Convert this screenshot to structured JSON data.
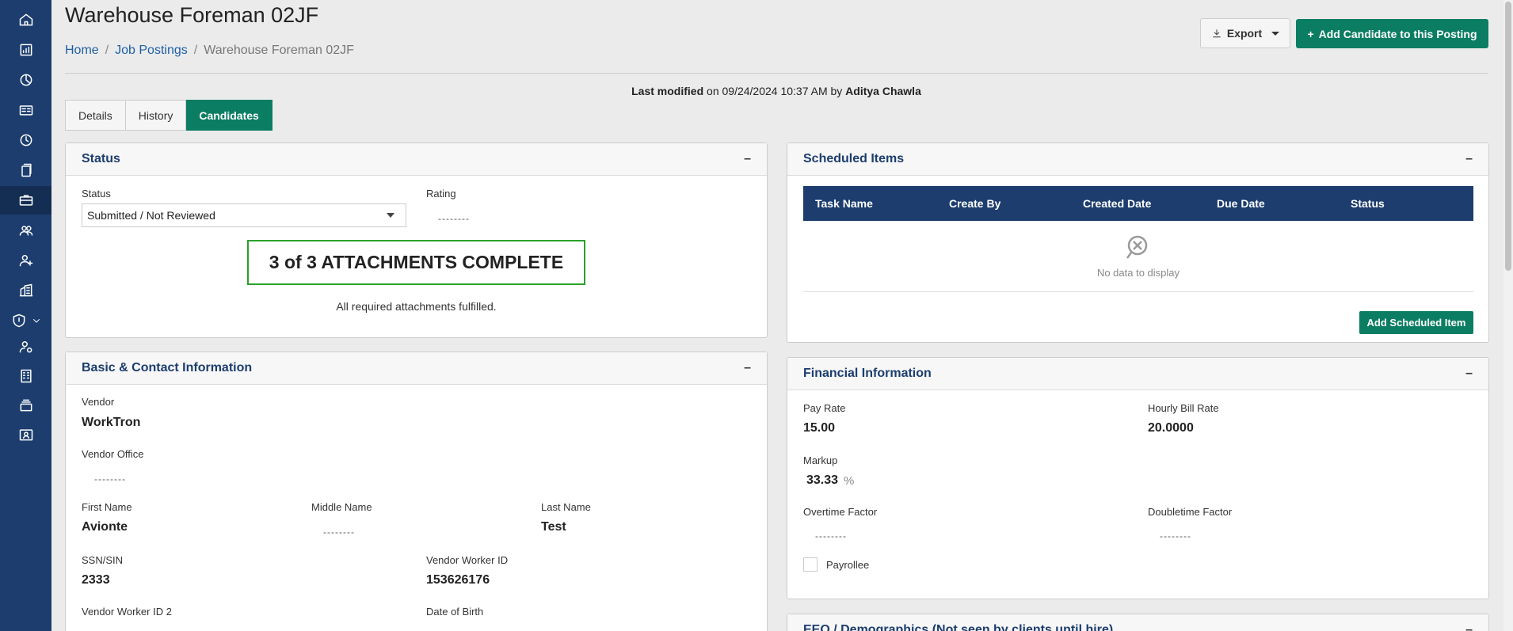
{
  "sidebar": {
    "items": [
      {
        "icon": "home-icon"
      },
      {
        "icon": "bar-chart-icon"
      },
      {
        "icon": "pie-chart-icon"
      },
      {
        "icon": "id-card-icon"
      },
      {
        "icon": "clock-icon"
      },
      {
        "icon": "documents-icon"
      },
      {
        "icon": "briefcase-icon",
        "active": true
      },
      {
        "icon": "users-icon"
      },
      {
        "icon": "add-user-icon"
      },
      {
        "icon": "buildings-icon"
      },
      {
        "icon": "shield-icon"
      },
      {
        "icon": "user-settings-icon"
      },
      {
        "icon": "office-building-icon"
      },
      {
        "icon": "stack-icon"
      },
      {
        "icon": "contact-card-icon"
      }
    ]
  },
  "header": {
    "title": "Warehouse Foreman 02JF",
    "breadcrumb": [
      "Home",
      "Job Postings",
      "Warehouse Foreman 02JF"
    ],
    "breadcrumb_sep": "/",
    "export_label": "Export",
    "add_candidate_label": "Add Candidate to this Posting",
    "add_candidate_prefix": "+"
  },
  "last_modified": {
    "label": "Last modified",
    "on_text": "on 09/24/2024 10:37 AM by",
    "user": "Aditya Chawla"
  },
  "tabs": [
    {
      "label": "Details"
    },
    {
      "label": "History"
    },
    {
      "label": "Candidates",
      "active": true
    }
  ],
  "status_panel": {
    "title": "Status",
    "collapse": "–",
    "status_label": "Status",
    "status_value": "Submitted / Not Reviewed",
    "rating_label": "Rating",
    "rating_value": "--------",
    "attachments_banner": "3 of 3 ATTACHMENTS COMPLETE",
    "attachments_note": "All required attachments fulfilled."
  },
  "basic_panel": {
    "title": "Basic & Contact Information",
    "collapse": "–",
    "vendor_label": "Vendor",
    "vendor_value": "WorkTron",
    "vendor_office_label": "Vendor Office",
    "vendor_office_value": "--------",
    "first_name_label": "First Name",
    "first_name_value": "Avionte",
    "middle_name_label": "Middle Name",
    "middle_name_value": "--------",
    "last_name_label": "Last Name",
    "last_name_value": "Test",
    "ssn_label": "SSN/SIN",
    "ssn_value": "2333",
    "vendor_worker_id_label": "Vendor Worker ID",
    "vendor_worker_id_value": "153626176",
    "vendor_worker_id2_label": "Vendor Worker ID 2",
    "dob_label": "Date of Birth"
  },
  "scheduled_panel": {
    "title": "Scheduled Items",
    "collapse": "–",
    "columns": [
      "Task Name",
      "Create By",
      "Created Date",
      "Due Date",
      "Status"
    ],
    "empty_text": "No data to display",
    "add_label": "Add Scheduled Item"
  },
  "financial_panel": {
    "title": "Financial Information",
    "collapse": "–",
    "pay_rate_label": "Pay Rate",
    "pay_rate_value": "15.00",
    "hourly_bill_label": "Hourly Bill Rate",
    "hourly_bill_value": "20.0000",
    "markup_label": "Markup",
    "markup_value": "33.33",
    "markup_unit": "%",
    "overtime_label": "Overtime Factor",
    "overtime_value": "--------",
    "doubletime_label": "Doubletime Factor",
    "doubletime_value": "--------",
    "payrollee_label": "Payrollee"
  },
  "eeo_panel": {
    "title": "EEO / Demographics (Not seen by clients until hire)",
    "collapse": "–"
  },
  "colors": {
    "sidebar": "#1c3d6e",
    "accent_green": "#0b7d62",
    "panel_title": "#1c3d6e",
    "attachments_border": "#2aa02a"
  }
}
